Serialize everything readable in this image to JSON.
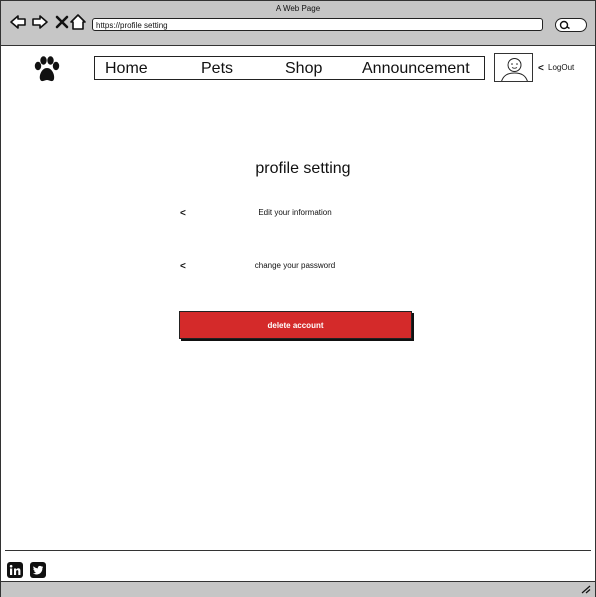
{
  "window": {
    "title": "A Web Page"
  },
  "browser": {
    "url": "https://profile setting",
    "icons": [
      "back-arrow-icon",
      "forward-arrow-icon",
      "close-icon",
      "home-icon",
      "search-icon"
    ]
  },
  "header": {
    "logo_icon": "paw-icon",
    "nav": [
      {
        "label": "Home"
      },
      {
        "label": "Pets"
      },
      {
        "label": "Shop"
      },
      {
        "label": "Announcement"
      }
    ],
    "avatar_icon": "user-avatar-icon",
    "logout_chevron": "<",
    "logout_label": "LogOut"
  },
  "main": {
    "title": "profile setting",
    "items": [
      {
        "chevron": "<",
        "label": "Edit your information"
      },
      {
        "chevron": "<",
        "label": "change your password"
      }
    ],
    "delete_label": "delete account"
  },
  "footer": {
    "icons": [
      "linkedin-icon",
      "twitter-icon"
    ]
  },
  "colors": {
    "danger": "#d42a2a",
    "chrome": "#c6c6c6"
  }
}
